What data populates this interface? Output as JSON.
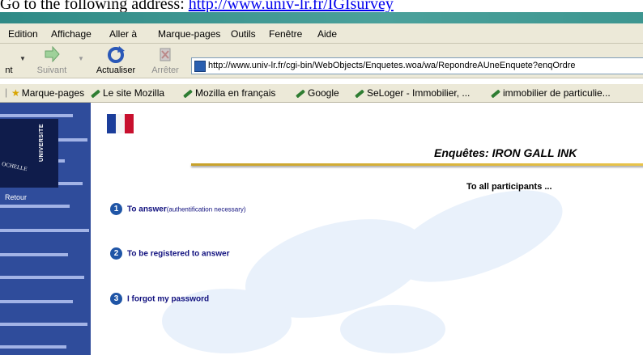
{
  "caption": {
    "prefix": "Go to the following address: ",
    "link": "http://www.univ-lr.fr/IGIsurvey"
  },
  "menubar": {
    "items": [
      "Edition",
      "Affichage",
      "Aller à",
      "Marque-pages",
      "Outils",
      "Fenêtre",
      "Aide"
    ]
  },
  "toolbar": {
    "back_label": "nt",
    "forward_label": "Suivant",
    "reload_label": "Actualiser",
    "stop_label": "Arrêter",
    "url": "http://www.univ-lr.fr/cgi-bin/WebObjects/Enquetes.woa/wa/RepondreAUneEnquete?enqOrdre"
  },
  "bookmarks": {
    "items": [
      "Marque-pages",
      "Le site Mozilla",
      "Mozilla en français",
      "Google",
      "SeLoger - Immobilier, ...",
      "immobilier de particulie..."
    ]
  },
  "sidebar": {
    "logo_vertical": "UNIVERSITE",
    "logo_arc": "OCHELLE",
    "retour_label": "Retour"
  },
  "page": {
    "title": "Enquêtes:  IRON GALL INK",
    "subtitle": "To all participants ...",
    "options": [
      {
        "number": "1",
        "label": "To answer",
        "note": "(authentification necessary)"
      },
      {
        "number": "2",
        "label": "To be registered to answer",
        "note": ""
      },
      {
        "number": "3",
        "label": "I forgot my password",
        "note": ""
      }
    ]
  },
  "colors": {
    "accent_blue": "#2f4c9b",
    "gold": "#c7a12a",
    "link_blue": "#10107e"
  }
}
